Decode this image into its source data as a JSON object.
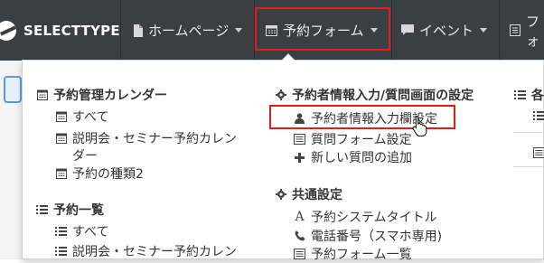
{
  "navbar": {
    "brand": "SELECTTYPE",
    "items": [
      {
        "label": "ホームページ",
        "icon": "document-icon"
      },
      {
        "label": "予約フォーム",
        "icon": "calendar-icon"
      },
      {
        "label": "イベント",
        "icon": "comment-icon"
      },
      {
        "label": "フォ",
        "icon": "list-box-icon"
      }
    ]
  },
  "menu": {
    "col1": {
      "calendar_heading": "予約管理カレンダー",
      "calendar_items": [
        "すべて",
        "説明会・セミナー予約カレン",
        "ダー",
        "予約の種類2"
      ],
      "list_heading": "予約一覧",
      "list_items": [
        "すべて",
        "説明会・セミナー予約カレン"
      ]
    },
    "col2": {
      "input_heading": "予約者情報入力/質問画面の設定",
      "input_items": [
        "予約者情報入力欄設定",
        "質問フォーム設定",
        "新しい質問の追加"
      ],
      "common_heading": "共通設定",
      "common_items": [
        "予約システムタイトル",
        "電話番号（スマホ専用)",
        "予約フォーム一覧"
      ]
    },
    "col3": {
      "heading_fragment": "各"
    }
  }
}
